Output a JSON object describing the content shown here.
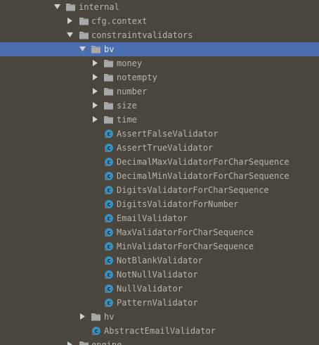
{
  "tree": [
    {
      "label": "internal",
      "type": "folder",
      "expanded": true,
      "depth": 0
    },
    {
      "label": "cfg.context",
      "type": "folder",
      "expanded": false,
      "depth": 1
    },
    {
      "label": "constraintvalidators",
      "type": "folder",
      "expanded": true,
      "depth": 1
    },
    {
      "label": "bv",
      "type": "folder",
      "expanded": true,
      "depth": 2,
      "selected": true
    },
    {
      "label": "money",
      "type": "folder",
      "expanded": false,
      "depth": 3
    },
    {
      "label": "notempty",
      "type": "folder",
      "expanded": false,
      "depth": 3
    },
    {
      "label": "number",
      "type": "folder",
      "expanded": false,
      "depth": 3
    },
    {
      "label": "size",
      "type": "folder",
      "expanded": false,
      "depth": 3
    },
    {
      "label": "time",
      "type": "folder",
      "expanded": false,
      "depth": 3
    },
    {
      "label": "AssertFalseValidator",
      "type": "class",
      "depth": 3
    },
    {
      "label": "AssertTrueValidator",
      "type": "class",
      "depth": 3
    },
    {
      "label": "DecimalMaxValidatorForCharSequence",
      "type": "class",
      "depth": 3
    },
    {
      "label": "DecimalMinValidatorForCharSequence",
      "type": "class",
      "depth": 3
    },
    {
      "label": "DigitsValidatorForCharSequence",
      "type": "class",
      "depth": 3
    },
    {
      "label": "DigitsValidatorForNumber",
      "type": "class",
      "depth": 3
    },
    {
      "label": "EmailValidator",
      "type": "class",
      "depth": 3
    },
    {
      "label": "MaxValidatorForCharSequence",
      "type": "class",
      "depth": 3
    },
    {
      "label": "MinValidatorForCharSequence",
      "type": "class",
      "depth": 3
    },
    {
      "label": "NotBlankValidator",
      "type": "class",
      "depth": 3
    },
    {
      "label": "NotNullValidator",
      "type": "class",
      "depth": 3
    },
    {
      "label": "NullValidator",
      "type": "class",
      "depth": 3
    },
    {
      "label": "PatternValidator",
      "type": "class",
      "depth": 3
    },
    {
      "label": "hv",
      "type": "folder",
      "expanded": false,
      "depth": 2
    },
    {
      "label": "AbstractEmailValidator",
      "type": "class",
      "depth": 2
    },
    {
      "label": "engine",
      "type": "folder",
      "expanded": false,
      "depth": 1
    }
  ],
  "colors": {
    "background": "#4b463d",
    "selection": "#4b6eaf",
    "text": "#b9b5ad",
    "folder": "#a9a9a9",
    "class_icon": "#3592c4"
  }
}
